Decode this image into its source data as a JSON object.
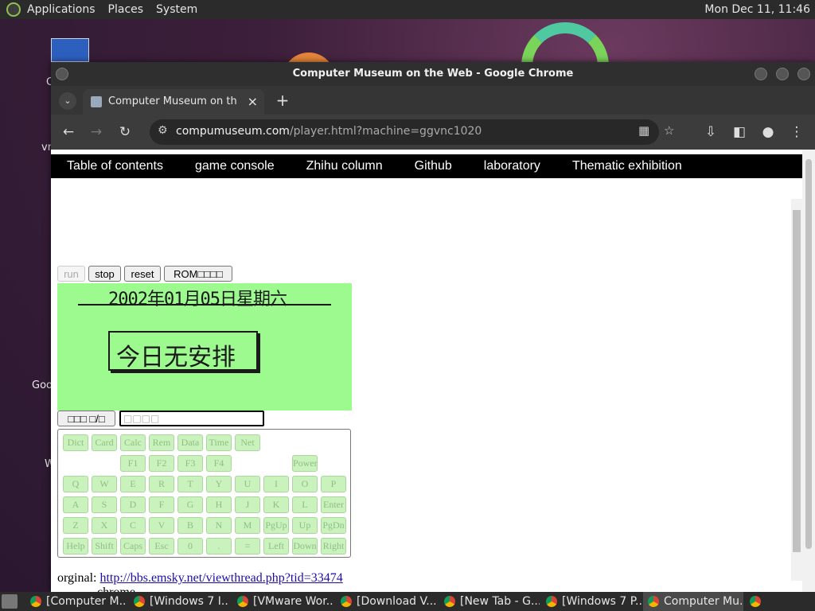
{
  "top_panel": {
    "menus": [
      "Applications",
      "Places",
      "System"
    ],
    "clock": "Mon Dec 11, 11:46"
  },
  "desktop": {
    "icon_labels": [
      "C",
      "vn",
      "Goo",
      "W"
    ]
  },
  "window": {
    "title": "Computer Museum on the Web - Google Chrome"
  },
  "tab": {
    "title": "Computer Museum on the W",
    "close_icon": "close-icon",
    "new_tab_icon": "plus-icon"
  },
  "address": {
    "host": "compumuseum.com",
    "path": "/player.html?machine=ggvnc1020"
  },
  "nav_items": [
    "Table of contents",
    "game console",
    "Zhihu column",
    "Github",
    "laboratory",
    "Thematic exhibition"
  ],
  "controls": {
    "run": "run",
    "stop": "stop",
    "reset": "reset",
    "rom": "ROM□□□□",
    "toggle": "□□□ □/□",
    "input_placeholder": "□□□□"
  },
  "screen": {
    "date": "2002年01月05日星期六",
    "message": "今日无安排"
  },
  "keypad_rows": [
    [
      "Dict",
      "Card",
      "Calc",
      "Rem",
      "Data",
      "Time",
      "Net"
    ],
    [
      "F1",
      "F2",
      "F3",
      "F4",
      "Power"
    ],
    [
      "Q",
      "W",
      "E",
      "R",
      "T",
      "Y",
      "U",
      "I",
      "O",
      "P"
    ],
    [
      "A",
      "S",
      "D",
      "F",
      "G",
      "H",
      "J",
      "K",
      "L",
      "Enter"
    ],
    [
      "Z",
      "X",
      "C",
      "V",
      "B",
      "N",
      "M",
      "PgUp",
      "Up",
      "PgDn"
    ],
    [
      "Help",
      "Shift",
      "Caps",
      "Esc",
      "0",
      ".",
      "=",
      "Left",
      "Down",
      "Right"
    ]
  ],
  "original": {
    "label": "orginal:",
    "link": "http://bbs.emsky.net/viewthread.php?tid=33474",
    "next_line": "chrome"
  },
  "taskbar": [
    "[Computer M...",
    "[Windows 7 I...",
    "[VMware Wor...",
    "[Download V...",
    "[New Tab - G...",
    "[Windows 7 P...",
    "Computer Mu..."
  ]
}
